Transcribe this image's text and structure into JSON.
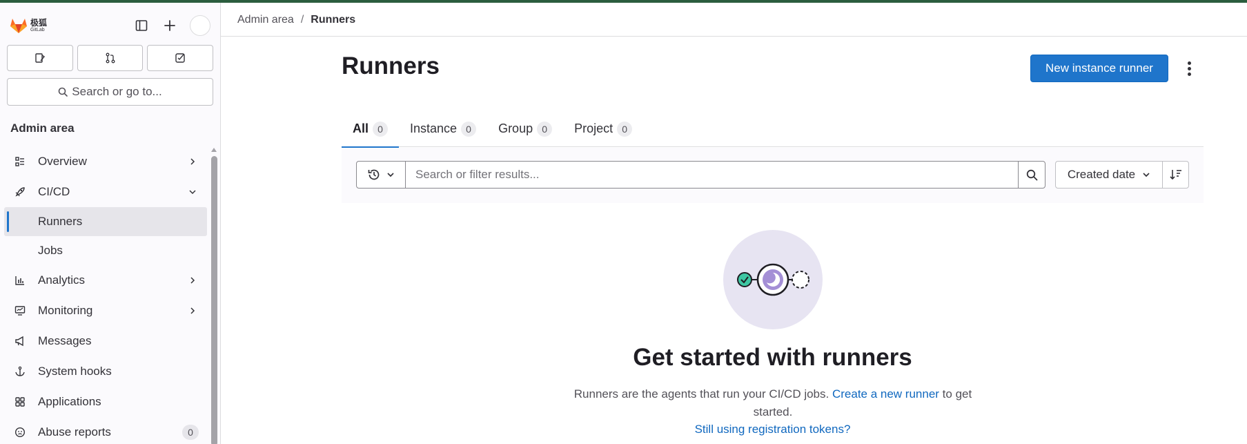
{
  "brand": {
    "cn_name": "极狐",
    "en_name": "GitLab",
    "accent": "#1f75cb",
    "top_border": "#2b5d3e"
  },
  "sidebar": {
    "search_label": "Search or go to...",
    "section_title": "Admin area",
    "items": [
      {
        "label": "Overview",
        "icon": "overview-icon",
        "expandable": true,
        "expanded": false
      },
      {
        "label": "CI/CD",
        "icon": "rocket-icon",
        "expandable": true,
        "expanded": true
      },
      {
        "label": "Runners",
        "sub": true,
        "active": true
      },
      {
        "label": "Jobs",
        "sub": true
      },
      {
        "label": "Analytics",
        "icon": "chart-icon",
        "expandable": true,
        "expanded": false
      },
      {
        "label": "Monitoring",
        "icon": "monitor-icon",
        "expandable": true,
        "expanded": false
      },
      {
        "label": "Messages",
        "icon": "bullhorn-icon"
      },
      {
        "label": "System hooks",
        "icon": "anchor-icon"
      },
      {
        "label": "Applications",
        "icon": "apps-icon"
      },
      {
        "label": "Abuse reports",
        "icon": "abuse-icon",
        "count": "0"
      }
    ]
  },
  "breadcrumb": {
    "parent": "Admin area",
    "separator": "/",
    "current": "Runners"
  },
  "page": {
    "title": "Runners",
    "new_runner_button": "New instance runner"
  },
  "tabs": [
    {
      "label": "All",
      "count": "0",
      "active": true
    },
    {
      "label": "Instance",
      "count": "0"
    },
    {
      "label": "Group",
      "count": "0"
    },
    {
      "label": "Project",
      "count": "0"
    }
  ],
  "filter": {
    "placeholder": "Search or filter results...",
    "sort_label": "Created date"
  },
  "empty_state": {
    "title": "Get started with runners",
    "desc_prefix": "Runners are the agents that run your CI/CD jobs. ",
    "desc_link": "Create a new runner",
    "desc_suffix": " to get started.",
    "registration_link": "Still using registration tokens?"
  }
}
